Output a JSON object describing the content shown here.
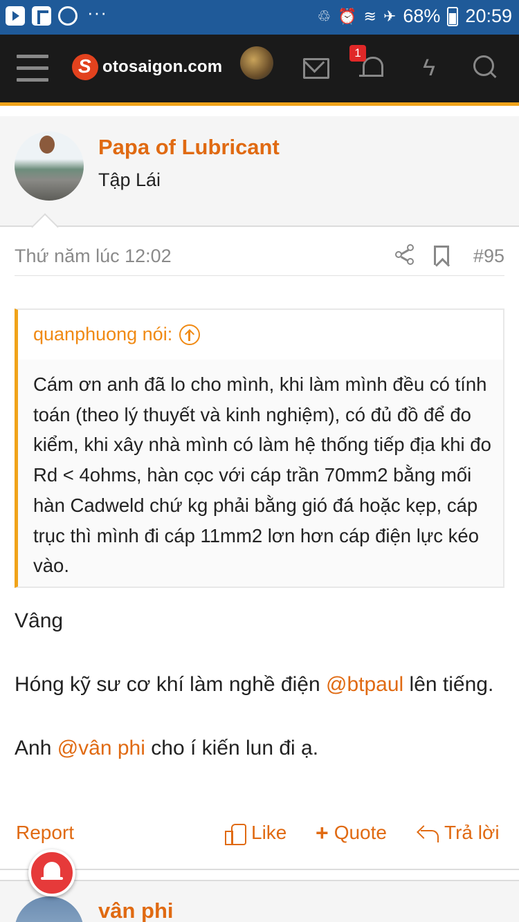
{
  "status_bar": {
    "icons_left": [
      "youtube-icon",
      "flipboard-icon",
      "viber-icon"
    ],
    "dots": "···",
    "battery": "68%",
    "time": "20:59"
  },
  "header": {
    "site_name": "otosaigon.com",
    "notification_count": "1"
  },
  "post": {
    "author": "Papa of Lubricant",
    "author_title": "Tập Lái",
    "date": "Thứ năm lúc 12:02",
    "number": "#95",
    "quote": {
      "author": "quanphuong nói:",
      "text": "Cám ơn anh đã lo cho mình, khi làm mình đều có tính toán (theo lý thuyết và kinh nghiệm), có đủ đồ để đo kiểm, khi xây nhà mình có làm hệ thống tiếp địa khi đo Rd < 4ohms, hàn cọc với cáp trần 70mm2 bằng mối hàn Cadweld chứ kg phải bằng gió đá hoặc kẹp, cáp trục thì mình đi cáp 11mm2 lơn hơn cáp điện lực kéo vào."
    },
    "body": {
      "line1": "Vâng",
      "line2_pre": "Hóng kỹ sư cơ khí làm nghề điện ",
      "line2_mention": "@btpaul",
      "line2_post": " lên tiếng.",
      "line3_pre": "Anh ",
      "line3_mention": "@vân phi",
      "line3_post": " cho í kiến lun đi ạ."
    },
    "actions": {
      "report": "Report",
      "like": "Like",
      "quote": "Quote",
      "reply": "Trả lời"
    }
  },
  "next_post": {
    "author": "vân phi"
  },
  "colors": {
    "accent": "#e06a12",
    "header_bg": "#1a1a1a",
    "header_line": "#f0a31a",
    "status_bar": "#1f5a99"
  }
}
